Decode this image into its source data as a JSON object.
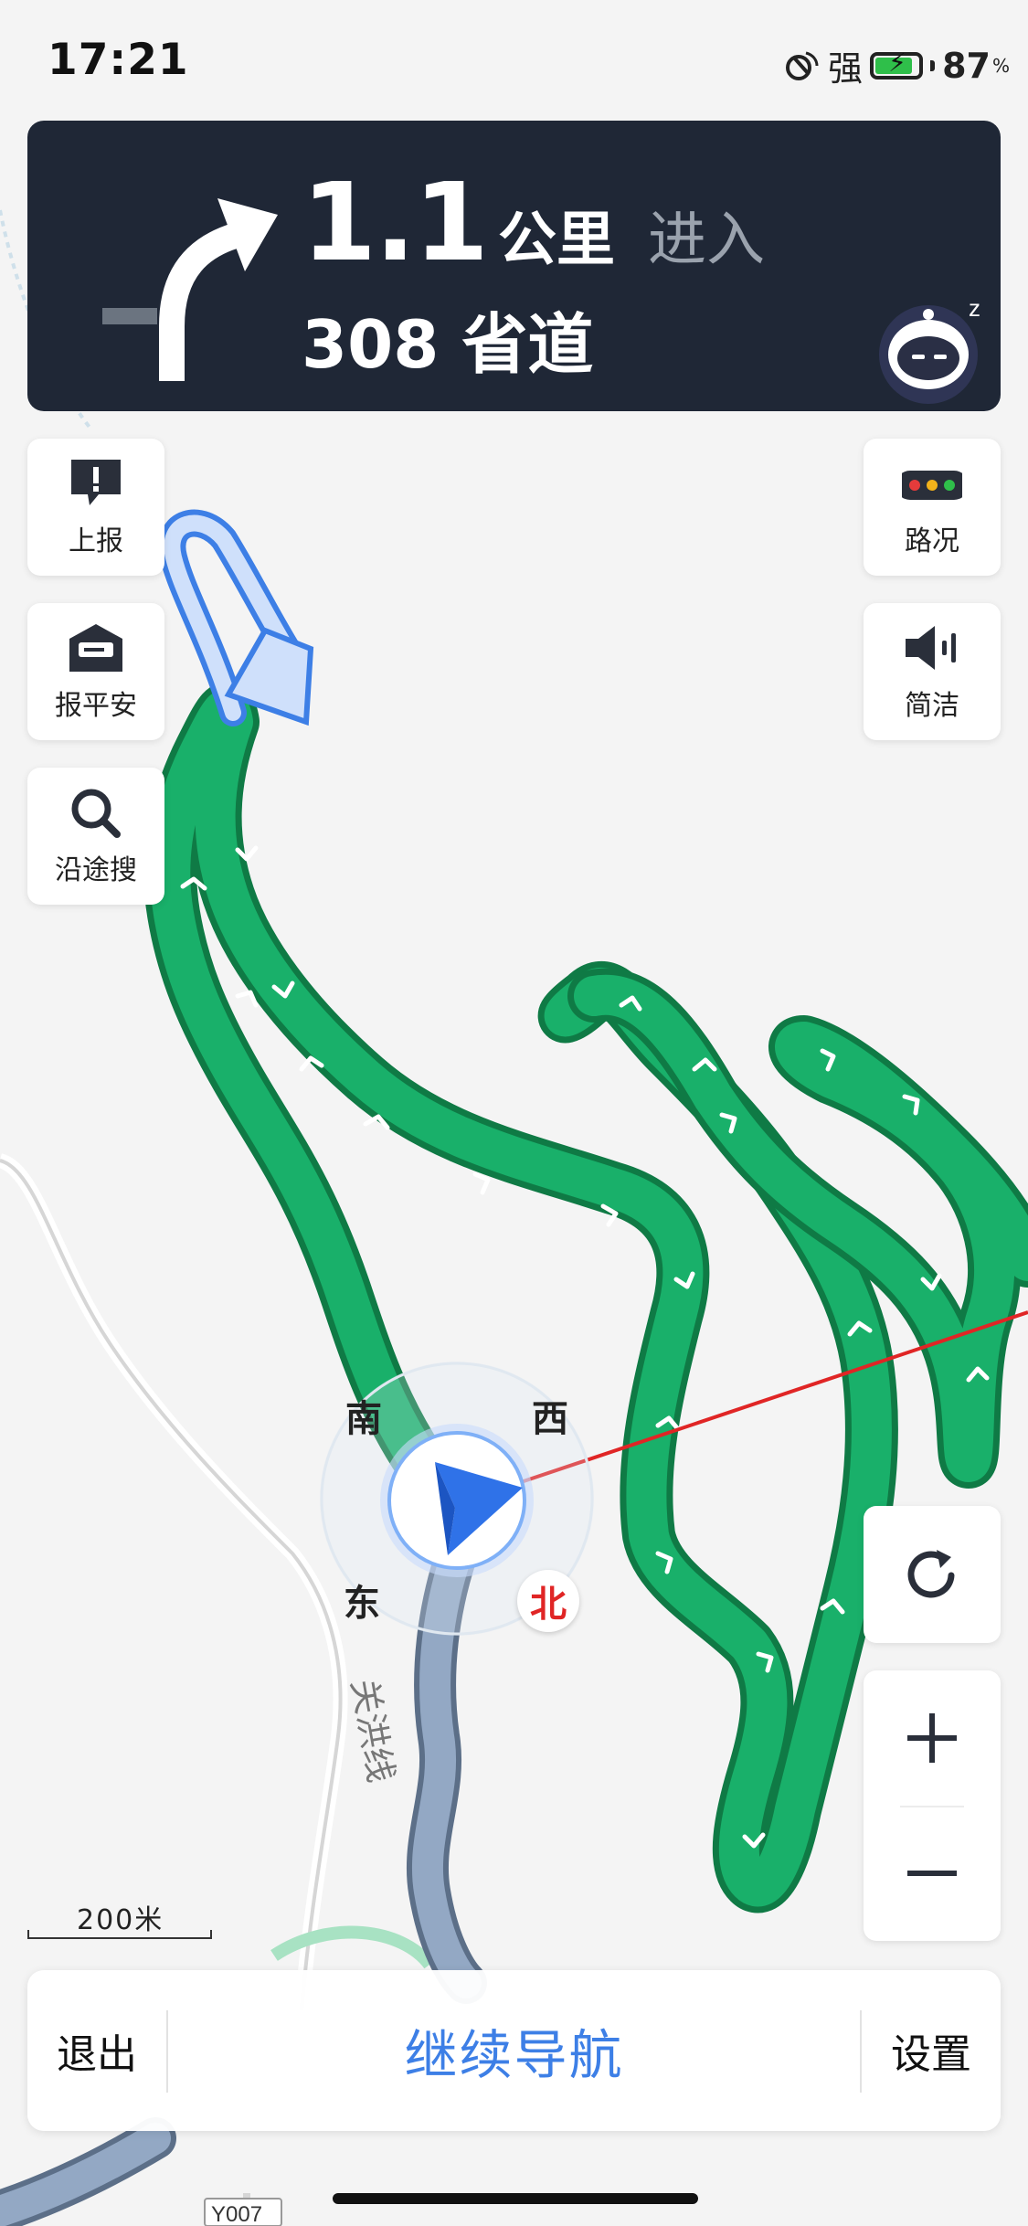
{
  "status_bar": {
    "time": "17:21",
    "signal_text": "强",
    "battery_percent": "87",
    "percent_sign": "%",
    "battery_level": 0.87
  },
  "guidance": {
    "distance_value": "1.1",
    "distance_unit": "公里",
    "action": "进入",
    "road_name": "308 省道",
    "turn_icon": "turn-right-arrow-icon"
  },
  "side_buttons": {
    "report": "上报",
    "safety": "报平安",
    "search_along": "沿途搜",
    "traffic": "路况",
    "voice_mode": "简洁"
  },
  "compass": {
    "south": "南",
    "west": "西",
    "east": "东",
    "north": "北"
  },
  "map": {
    "road_label": "关洪线",
    "road_code": "Y007",
    "scale_label": "200米"
  },
  "bottom_bar": {
    "exit": "退出",
    "continue": "继续导航",
    "settings": "设置"
  },
  "colors": {
    "banner_bg": "#1f2736",
    "route_green": "#17a660",
    "route_passed": "#8fa3bd",
    "accent_blue": "#3d7fe6",
    "north_red": "#e02525"
  }
}
